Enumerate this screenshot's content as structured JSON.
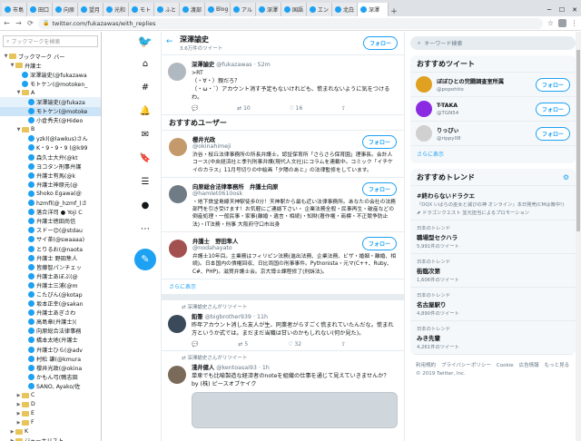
{
  "browser": {
    "tabs": [
      "市島",
      "田口",
      "向原",
      "望月",
      "光和",
      "モト",
      "ふと",
      "渡部",
      "Blog",
      "アル",
      "深澤",
      "国語",
      "エン",
      "北白",
      "深澤"
    ],
    "url": "twitter.com/fukazawas/with_replies"
  },
  "bookmarks": {
    "search_placeholder": "ブックマークを検索",
    "items": [
      {
        "label": "ブックマーク バー",
        "type": "folder",
        "indent": 0,
        "arrow": "▼"
      },
      {
        "label": "弁護士",
        "type": "folder",
        "indent": 1,
        "arrow": "▼"
      },
      {
        "label": "深澤諭史(@fukazawa",
        "type": "tw",
        "indent": 2,
        "arrow": ""
      },
      {
        "label": "モトケン(@motoken_",
        "type": "tw",
        "indent": 2,
        "arrow": ""
      },
      {
        "label": "A",
        "type": "folder",
        "indent": 2,
        "arrow": "▼"
      },
      {
        "label": "深澤諭史(@fukaza",
        "type": "tw",
        "indent": 3,
        "arrow": "",
        "state": "sel2"
      },
      {
        "label": "モトケン(@motoke",
        "type": "tw",
        "indent": 3,
        "arrow": "",
        "state": "sel"
      },
      {
        "label": "小倉秀夫(@Hideo",
        "type": "tw",
        "indent": 3,
        "arrow": ""
      },
      {
        "label": "B",
        "type": "folder",
        "indent": 2,
        "arrow": "▼"
      },
      {
        "label": "yzkl(@lawkus)さん",
        "type": "tw",
        "indent": 3,
        "arrow": ""
      },
      {
        "label": "K・9・9・9 (@k99",
        "type": "tw",
        "indent": 3,
        "arrow": ""
      },
      {
        "label": "森久士大弁(@kt",
        "type": "tw",
        "indent": 3,
        "arrow": ""
      },
      {
        "label": "ヨコタン刑事弁護",
        "type": "tw",
        "indent": 3,
        "arrow": ""
      },
      {
        "label": "弁護士有馬(@k",
        "type": "tw",
        "indent": 3,
        "arrow": ""
      },
      {
        "label": "弁護士神原元(@",
        "type": "tw",
        "indent": 3,
        "arrow": ""
      },
      {
        "label": "Shoko Egawa(@",
        "type": "tw",
        "indent": 3,
        "arrow": ""
      },
      {
        "label": "hzmfl(@_hzmf_)さ",
        "type": "tw",
        "indent": 3,
        "arrow": ""
      },
      {
        "label": "落合洋司 ● Yoji C",
        "type": "tw",
        "indent": 3,
        "arrow": ""
      },
      {
        "label": "弁護士徳田尚信",
        "type": "tw",
        "indent": 3,
        "arrow": ""
      },
      {
        "label": "スドー😊(@stdau",
        "type": "tw",
        "indent": 3,
        "arrow": ""
      },
      {
        "label": "サイ茶(@swaaaa)",
        "type": "tw",
        "indent": 3,
        "arrow": ""
      },
      {
        "label": "とりるお(@naota",
        "type": "tw",
        "indent": 3,
        "arrow": ""
      },
      {
        "label": "弁護士 野田隼人",
        "type": "tw",
        "indent": 3,
        "arrow": ""
      },
      {
        "label": "皆藤智パンチェッ",
        "type": "tw",
        "indent": 3,
        "arrow": ""
      },
      {
        "label": "弁護士あぼぶ(@",
        "type": "tw",
        "indent": 3,
        "arrow": ""
      },
      {
        "label": "弁護士三浦(@m",
        "type": "tw",
        "indent": 3,
        "arrow": ""
      },
      {
        "label": "こたぴん(@kotap",
        "type": "tw",
        "indent": 3,
        "arrow": ""
      },
      {
        "label": "坂本正幸(@sakan",
        "type": "tw",
        "indent": 3,
        "arrow": ""
      },
      {
        "label": "弁護士あぎさわ",
        "type": "tw",
        "indent": 3,
        "arrow": ""
      },
      {
        "label": "高島章(弁護士)(",
        "type": "tw",
        "indent": 3,
        "arrow": ""
      },
      {
        "label": "向原総合法律事務",
        "type": "tw",
        "indent": 3,
        "arrow": ""
      },
      {
        "label": "橋本太地(弁護士",
        "type": "tw",
        "indent": 3,
        "arrow": ""
      },
      {
        "label": "弁護士ひら(@adv",
        "type": "tw",
        "indent": 3,
        "arrow": ""
      },
      {
        "label": "村松 謙(@kmura",
        "type": "tw",
        "indent": 3,
        "arrow": ""
      },
      {
        "label": "櫻井光政(@okina",
        "type": "tw",
        "indent": 3,
        "arrow": ""
      },
      {
        "label": "かもん弓(鴨志田",
        "type": "tw",
        "indent": 3,
        "arrow": ""
      },
      {
        "label": "SANO, Ayako/佐",
        "type": "tw",
        "indent": 3,
        "arrow": ""
      },
      {
        "label": "C",
        "type": "folder",
        "indent": 2,
        "arrow": "▶"
      },
      {
        "label": "D",
        "type": "folder",
        "indent": 2,
        "arrow": "▶"
      },
      {
        "label": "E",
        "type": "folder",
        "indent": 2,
        "arrow": "▶"
      },
      {
        "label": "F",
        "type": "folder",
        "indent": 2,
        "arrow": "▶"
      },
      {
        "label": "K",
        "type": "folder",
        "indent": 1,
        "arrow": "▶"
      },
      {
        "label": "ジャーナリスト",
        "type": "folder",
        "indent": 1,
        "arrow": "▶"
      }
    ]
  },
  "profile": {
    "name": "深澤諭史",
    "tweet_count": "3.6万件のツイート",
    "follow_label": "フォロー"
  },
  "top_tweet": {
    "name": "深澤諭史",
    "handle": "@fukazawas",
    "time": "52m",
    "text": ">RT\n（・∀・）親だろ？\n（・ω・`）アカウント消す予定もないけれども、慌まれないように気をつけるわ。",
    "replies": "",
    "retweets": "10",
    "likes": "16",
    "share": ""
  },
  "recommended": {
    "title": "おすすめユーザー",
    "users": [
      {
        "name": "櫻井光政",
        "handle": "@okinahimeji",
        "bio": "渋谷・桜丘法律事務所の所長弁護士。認証保育所「さらさら保育園」理事長。会計人コース(中央経済社と季刊刑事弁護(現代人文社)にコラムを連載中。コミック「イチケイのカラス」11月号切りの中絵画「夕陽のあと」の法律監修をしています。"
      },
      {
        "name": "向原総合法律事務所　弁護士向原",
        "handle": "@hamlet0610osk",
        "bio": "・地下鉄堂島線天神駅徒歩0分！天神駅から最も近い法律事務所。あなたの会社の法務部門を引き受けます！お気軽にご連絡下さい・ 企業法務全般・民事再生・破産などの倒産処理・一般民事・家事(離婚・遺言・相続)・知財(著作権・商標・不正競争防止法)・IT法務・刑事 大阪府守口市出身"
      },
      {
        "name": "弁護士　野田隼人",
        "handle": "@nodahayato",
        "bio": "弁護士10年目。主業務はフィリピン法務(進出法務、企業法務、ビザ・婚姻・離婚、相続)。日本国内の債権回収、日比両国の刑事事件。Pythonista・元マ(C++、Ruby、C#、PHP)。滋賀弁護士会。京大博士課程修了(刑訴法)。"
      }
    ],
    "more_label": "さらに表示"
  },
  "retweets": [
    {
      "rt_label": "深澤諭史さんがリツイート",
      "name": "鉛筆",
      "handle": "@bigbrother939",
      "time": "11h",
      "text": "昨年アカウント消した友人が生、同業者がらすごく慌まれていたんだな。慌まれ方というか式では。まだまだ当職は甘いのかもしれない(何か見た)。",
      "replies": "",
      "retweets": "5",
      "likes": "32",
      "share": ""
    },
    {
      "rt_label": "深澤諭史さんがリツイート",
      "name": "淺井健人",
      "handle": "@kentoasai93",
      "time": "1h",
      "text": "単車でも比喩製造な経済者のnoteを組織の仕事を通じて見えていきませんか？ by (株) ピースオブケイク"
    }
  ],
  "right": {
    "search_placeholder": "キーワード検索",
    "recommended_title": "おすすめツイート",
    "rec_users": [
      {
        "name": "ぼぼひとの完闘調査室所属",
        "handle": "@popohito"
      },
      {
        "name": "T-TAKA",
        "handle": "@TGN54"
      },
      {
        "name": "りっぴぃ",
        "handle": "@rippy08"
      }
    ],
    "follow_label": "フォロー",
    "more_label": "さらに表示",
    "trends_title": "おすすめトレンド",
    "trends": [
      {
        "label": "",
        "name": "#終わらないドラクエ",
        "count": "",
        "promo": "『DQX いばらの巫女と滅びの神 オンライン』本日発売(CMは微中!)",
        "promoted": "ドラゴンクエスト 並元担当によるプロモーション"
      },
      {
        "label": "日本のトレンド",
        "name": "職場型セクハラ",
        "count": "5,991件のツイート",
        "promo": "",
        "promoted": ""
      },
      {
        "label": "日本のトレンド",
        "name": "街臨次第",
        "count": "1,606件のツイート",
        "promo": "",
        "promoted": ""
      },
      {
        "label": "日本のトレンド",
        "name": "名古屋駅り",
        "count": "4,890件のツイート",
        "promo": "",
        "promoted": ""
      },
      {
        "label": "日本のトレンド",
        "name": "みき先輩",
        "count": "4,261件のツイート",
        "promo": "",
        "promoted": ""
      }
    ],
    "footer": {
      "links": [
        "利用規約",
        "プライバシーポリシー",
        "Cookie",
        "広告情報",
        "もっと見る"
      ],
      "copyright": "© 2019 Twitter, Inc."
    }
  },
  "colors": {
    "accent": "#1da1f2",
    "muted": "#657786",
    "border": "#e6ecf0"
  },
  "icons": [
    "twitter-logo-icon",
    "home-icon",
    "explore-icon",
    "notifications-icon",
    "messages-icon",
    "bookmarks-icon",
    "lists-icon",
    "profile-icon",
    "more-icon",
    "compose-icon",
    "settings-icon",
    "search-icon",
    "back-arrow-icon",
    "reply-icon",
    "retweet-icon",
    "like-icon",
    "share-icon",
    "chevron-down-icon"
  ]
}
